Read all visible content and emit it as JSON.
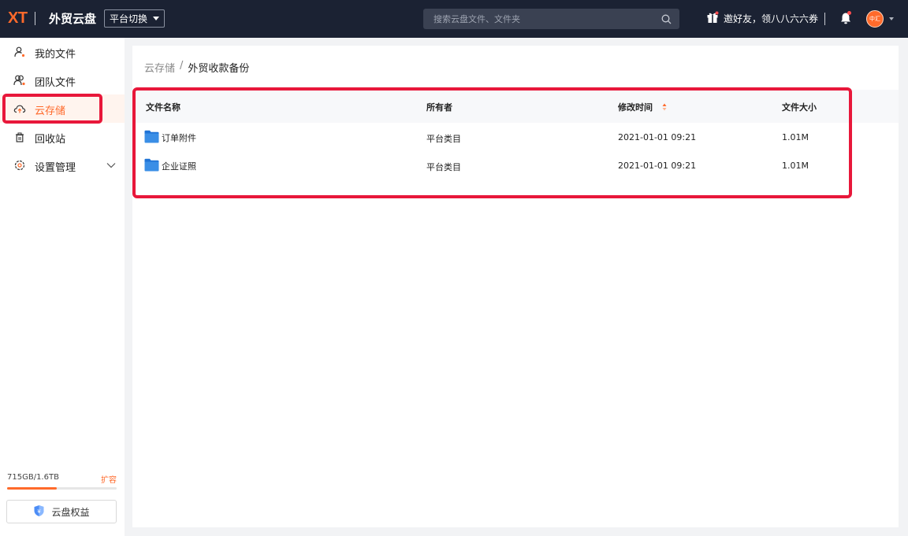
{
  "topbar": {
    "logo": "XT",
    "app_title": "外贸云盘",
    "platform_switch": "平台切换",
    "search_placeholder": "搜索云盘文件、文件夹",
    "invite_text": "邀好友，领八八六六券",
    "avatar_text": "中汇"
  },
  "sidebar": {
    "items": [
      {
        "label": "我的文件",
        "icon": "user-file-icon"
      },
      {
        "label": "团队文件",
        "icon": "team-icon"
      },
      {
        "label": "云存储",
        "icon": "cloud-upload-icon",
        "active": true
      },
      {
        "label": "回收站",
        "icon": "trash-icon"
      },
      {
        "label": "设置管理",
        "icon": "settings-icon"
      }
    ],
    "storage_text": "715GB/1.6TB",
    "storage_fraction": 0.45,
    "expand_label": "扩容",
    "rights_button": "云盘权益"
  },
  "breadcrumb": {
    "root": "云存储",
    "separator": "/",
    "current": "外贸收款备份"
  },
  "table": {
    "headers": [
      "文件名称",
      "所有者",
      "修改时间",
      "文件大小"
    ],
    "rows": [
      {
        "name": "订单附件",
        "owner": "平台类目",
        "modified": "2021-01-01 09:21",
        "size": "1.01M"
      },
      {
        "name": "企业证照",
        "owner": "平台类目",
        "modified": "2021-01-01 09:21",
        "size": "1.01M"
      }
    ]
  },
  "colors": {
    "accent": "#ff6a2b",
    "topbar_bg": "#1b2233",
    "highlight": "#e8173a",
    "folder": "#3a8ee6"
  }
}
